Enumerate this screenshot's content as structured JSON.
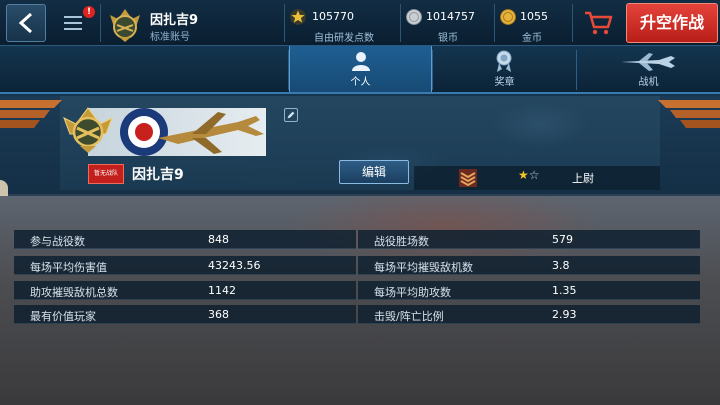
{
  "header": {
    "player_name": "因扎吉9",
    "account_type": "标准账号",
    "notification_count": "!",
    "currencies": [
      {
        "icon": "star-icon",
        "value": "105770",
        "label": "自由研发点数",
        "color": "#e9c23a"
      },
      {
        "icon": "silver-coin-icon",
        "value": "1014757",
        "label": "银币",
        "color": "#c9ced3"
      },
      {
        "icon": "gold-coin-icon",
        "value": "1055",
        "label": "金币",
        "color": "#e6b23a"
      }
    ],
    "launch_label": "升空作战"
  },
  "tabs": [
    {
      "label": "个人",
      "icon": "person-icon",
      "active": true
    },
    {
      "label": "奖章",
      "icon": "medal-icon",
      "active": false
    },
    {
      "label": "战机",
      "icon": "aircraft-icon",
      "active": false
    }
  ],
  "profile": {
    "name": "因扎吉9",
    "squad_tag": "暂无战队",
    "edit_label": "编辑",
    "rank_name": "上尉",
    "stars_filled": 1,
    "stars_total": 2
  },
  "stats": {
    "left": [
      {
        "label": "参与战役数",
        "value": "848"
      },
      {
        "label": "每场平均伤害值",
        "value": "43243.56"
      },
      {
        "label": "助攻摧毁敌机总数",
        "value": "1142"
      },
      {
        "label": "最有价值玩家",
        "value": "368"
      }
    ],
    "right": [
      {
        "label": "战役胜场数",
        "value": "579"
      },
      {
        "label": "每场平均摧毁敌机数",
        "value": "3.8"
      },
      {
        "label": "每场平均助攻数",
        "value": "1.35"
      },
      {
        "label": "击毁/阵亡比例",
        "value": "2.93"
      }
    ]
  },
  "colors": {
    "accent_blue": "#1f5f93",
    "launch_red": "#d2302a",
    "gold": "#f4c524"
  }
}
